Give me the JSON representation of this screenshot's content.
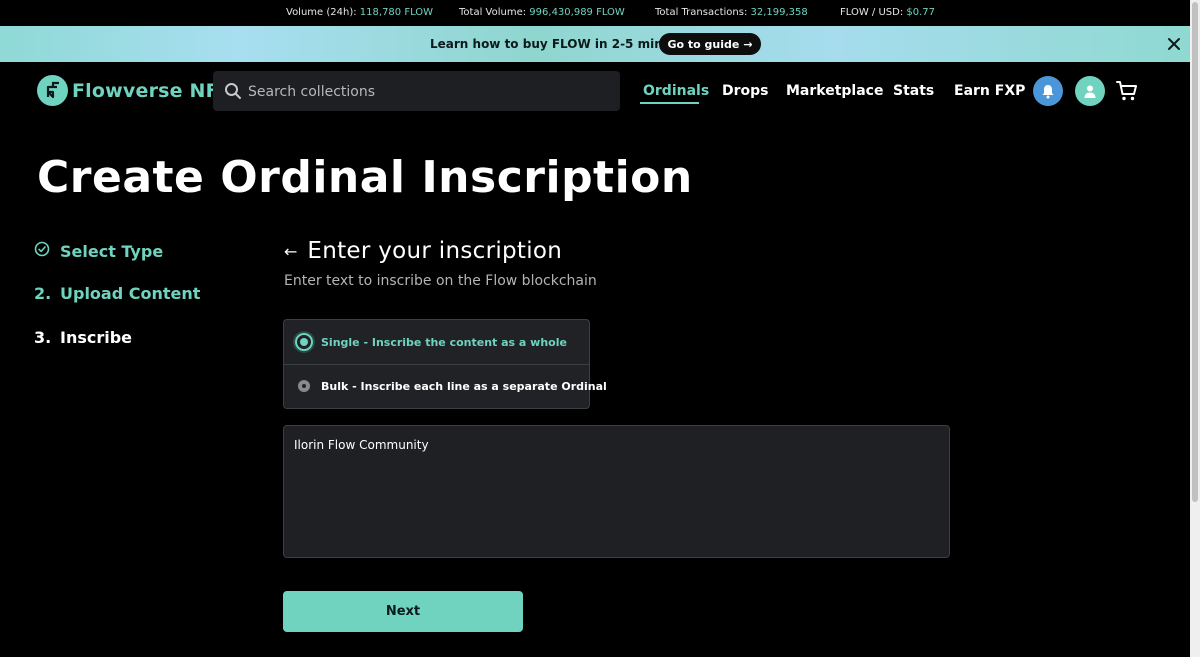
{
  "ticker": {
    "volume_label": "Volume (24h):",
    "volume_value": "118,780 FLOW",
    "total_volume_label": "Total Volume:",
    "total_volume_value": "996,430,989 FLOW",
    "transactions_label": "Total Transactions:",
    "transactions_value": "32,199,358",
    "price_label": "FLOW / USD:",
    "price_value": "$0.77"
  },
  "banner": {
    "message": "Learn how to buy FLOW in 2-5 minutes",
    "guide_label": "Go to guide",
    "guide_arrow": "→",
    "close_icon": "close-icon"
  },
  "nav": {
    "brand": "Flowverse NFT",
    "search_placeholder": "Search collections",
    "links": [
      "Ordinals",
      "Drops",
      "Marketplace",
      "Stats",
      "Earn FXP"
    ],
    "active_link": "Ordinals",
    "icons": [
      "notification-bell-icon",
      "user-avatar-icon",
      "cart-icon"
    ]
  },
  "page": {
    "title": "Create Ordinal Inscription"
  },
  "steps": [
    {
      "marker": "check-circle-icon",
      "label": "Select Type"
    },
    {
      "marker": "2.",
      "label": "Upload Content"
    },
    {
      "marker": "3.",
      "label": "Inscribe"
    }
  ],
  "form": {
    "back_arrow": "←",
    "title": "Enter your inscription",
    "subtitle": "Enter text to inscribe on the Flow blockchain",
    "options": [
      {
        "label": "Single - Inscribe the content as a whole",
        "selected": true
      },
      {
        "label": "Bulk - Inscribe each line as a separate Ordinal",
        "selected": false
      }
    ],
    "text_value": "Ilorin Flow Community",
    "next_label": "Next"
  },
  "colors": {
    "accent": "#6fd3c0",
    "background": "#000000",
    "panel": "#202225"
  }
}
